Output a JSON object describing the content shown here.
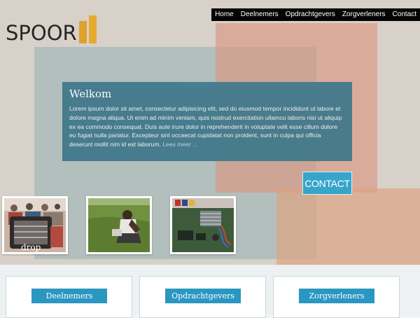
{
  "brand": {
    "name": "SPOOR"
  },
  "nav": {
    "items": [
      "Home",
      "Deelnemers",
      "Opdrachtgevers",
      "Zorgverleners",
      "Contact"
    ]
  },
  "welcome": {
    "title": "Welkom",
    "body": "Lorem ipsum dolor sit amet, consectetur adipisicing elit, sed do eiusmod tempor incididunt ut labore et dolore magna aliqua. Ut enim ad minim veniam, quis nostrud exercitation ullamco laboris nisi ut aliquip ex ea commodo consequat. Duis aute irure dolor in reprehenderit in voluptate velit esse cillum dolore eu fugiat nulla pariatur. Excepteur sint occaecat cupidatat non proident, sunt in culpa qui officia deserunt mollit nim id est laborum.",
    "more": "Lees meer ..."
  },
  "contact_button": "CONTACT",
  "thumbnails": [
    {
      "caption": "drop"
    },
    {
      "caption": ""
    },
    {
      "caption": ""
    }
  ],
  "cards": [
    {
      "title": "Deelnemers"
    },
    {
      "title": "Opdrachtgevers"
    },
    {
      "title": "Zorgverleners"
    }
  ],
  "colors": {
    "accent": "#2a97c1",
    "welcome_panel": "#3f788b",
    "logo": "#e5a32a",
    "nav_bg": "#050505"
  }
}
